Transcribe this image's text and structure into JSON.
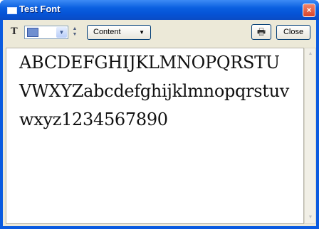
{
  "window": {
    "title": "Test Font",
    "close_glyph": "×"
  },
  "toolbar": {
    "font_icon_glyph": "T",
    "color_select": {
      "swatch_color": "#6f8fd0",
      "arrow": "▼"
    },
    "spinner": {
      "up": "▲",
      "down": "▼"
    },
    "content_dropdown": {
      "label": "Content",
      "arrow": "▼"
    },
    "print_glyph": "🖶",
    "close_label": "Close"
  },
  "preview": {
    "lines": [
      "ABCDEFGHIJKLMNOPQRSTU",
      "VWXYZabcdefghijklmnopqrstuv",
      "wxyz1234567890"
    ]
  },
  "scrollbar": {
    "up": "▲",
    "down": "▼"
  }
}
